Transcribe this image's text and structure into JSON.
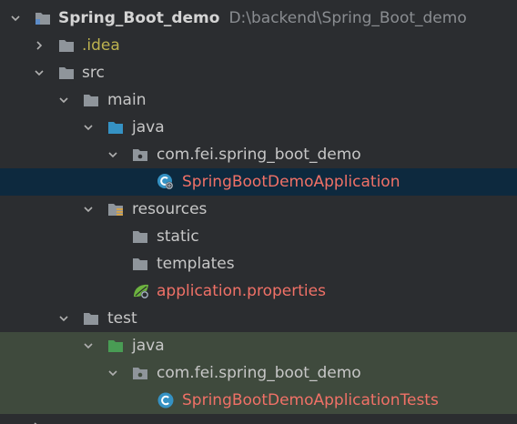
{
  "project": {
    "name": "Spring_Boot_demo",
    "path": "D:\\backend\\Spring_Boot_demo"
  },
  "tree": {
    "idea": ".idea",
    "src": "src",
    "main": "main",
    "main_java": "java",
    "main_package": "com.fei.spring_boot_demo",
    "main_class": "SpringBootDemoApplication",
    "resources": "resources",
    "static": "static",
    "templates": "templates",
    "properties": "application.properties",
    "test": "test",
    "test_java": "java",
    "test_package": "com.fei.spring_boot_demo",
    "test_class": "SpringBootDemoApplicationTests"
  },
  "colors": {
    "background": "#2b2d30",
    "selected_row": "#0d293e",
    "test_row": "#3f4a3d",
    "modified_text": "#f07167",
    "ignored_text": "#bdb24f",
    "source_folder": "#3592c4",
    "test_folder": "#499c54"
  },
  "icons": {
    "expand": "chevron-down-icon",
    "collapse": "chevron-right-icon",
    "folder": "folder-icon",
    "package": "package-icon",
    "class": "java-class-icon",
    "spring_properties": "spring-leaf-icon",
    "resources": "resources-folder-icon"
  }
}
